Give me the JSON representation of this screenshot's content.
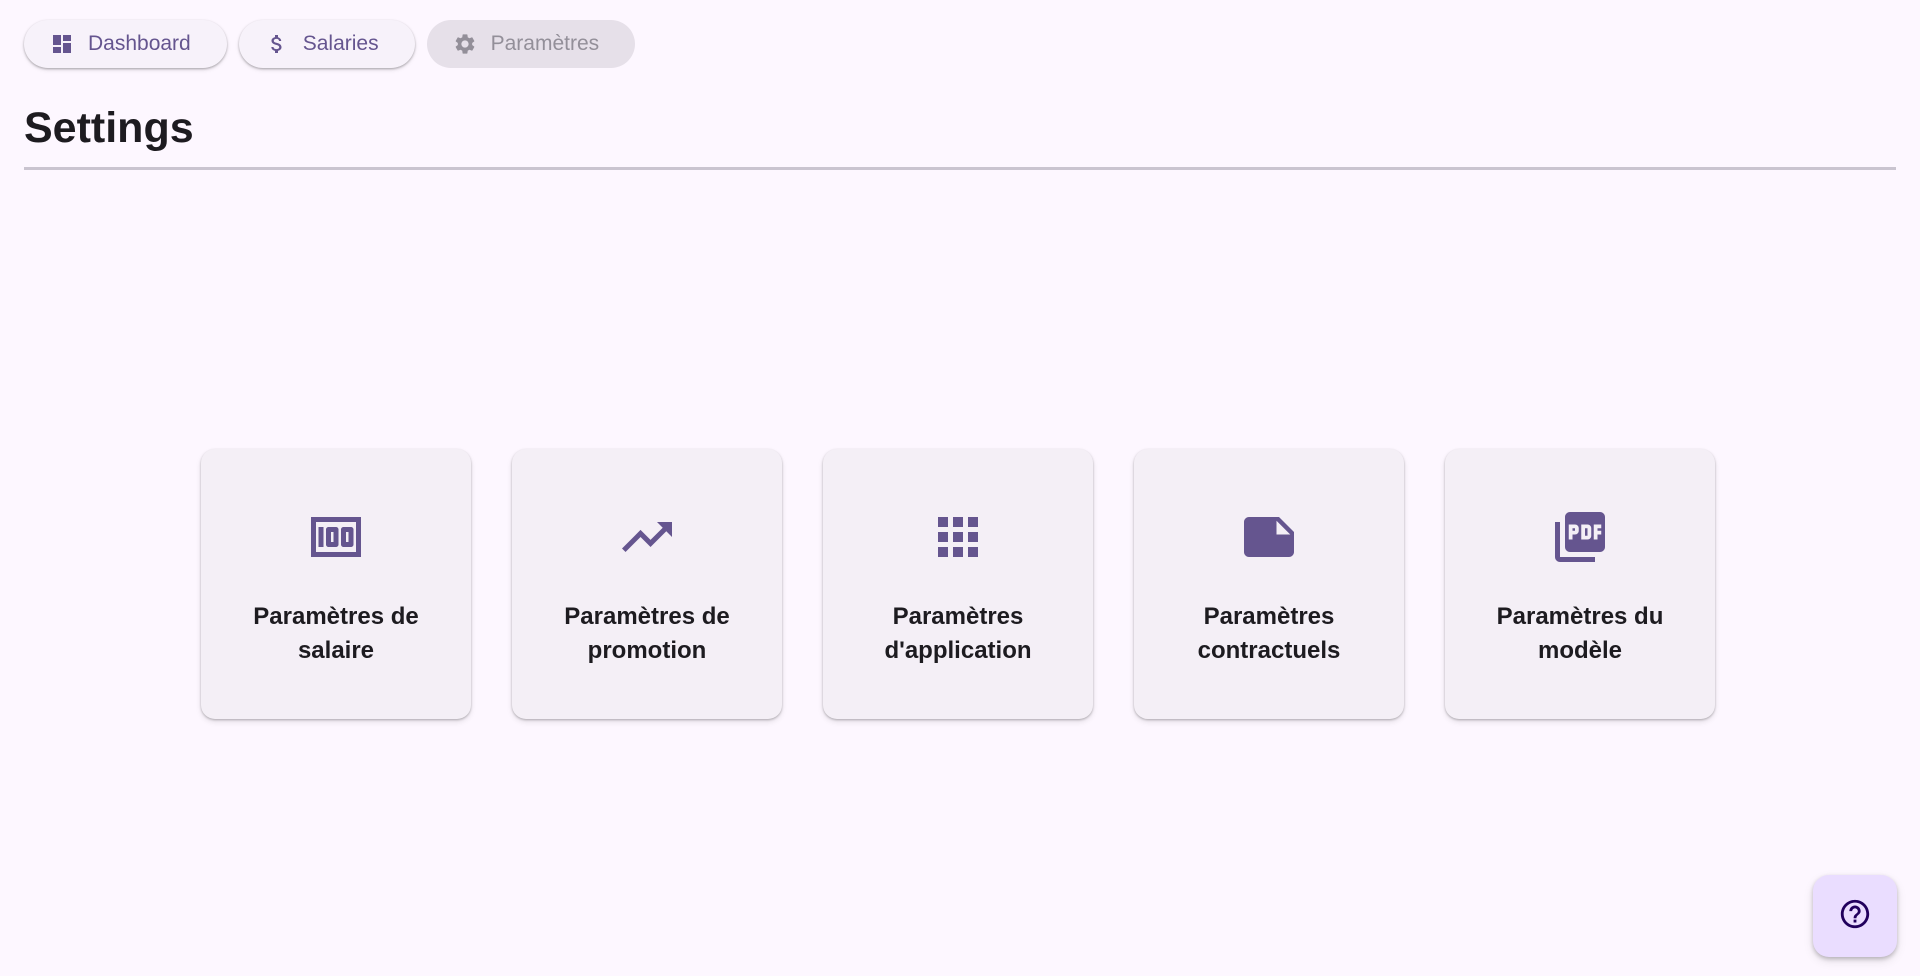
{
  "nav": {
    "items": [
      {
        "label": "Dashboard",
        "icon": "dashboard-icon"
      },
      {
        "label": "Salaries",
        "icon": "dollar-icon"
      },
      {
        "label": "Paramètres",
        "icon": "gear-icon",
        "disabled": true
      }
    ]
  },
  "page": {
    "title": "Settings"
  },
  "cards": [
    {
      "label": "Paramètres de\nsalaire",
      "icon": "money-100-icon"
    },
    {
      "label": "Paramètres de\npromotion",
      "icon": "trending-up-icon"
    },
    {
      "label": "Paramètres\nd'application",
      "icon": "apps-grid-icon"
    },
    {
      "label": "Paramètres\ncontractuels",
      "icon": "note-icon"
    },
    {
      "label": "Paramètres du\nmodèle",
      "icon": "pdf-icon"
    }
  ],
  "help": {
    "icon": "help-icon"
  },
  "colors": {
    "background": "#fdf7ff",
    "accent": "#65558f",
    "card": "#f4eff6",
    "fab": "#eaddff"
  }
}
